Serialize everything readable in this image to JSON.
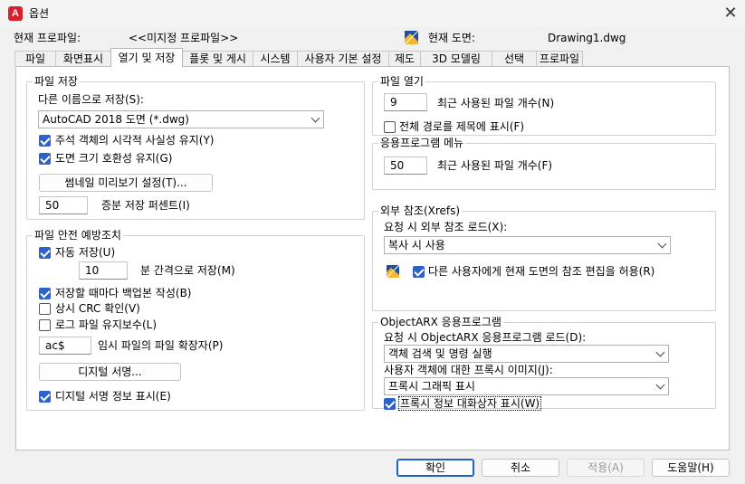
{
  "window": {
    "title": "옵션",
    "app_icon": "A",
    "close_glyph": "✕"
  },
  "header": {
    "profile_label": "현재 프로파일:",
    "profile_value": "<<미지정 프로파일>>",
    "drawing_label": "현재 도면:",
    "drawing_value": "Drawing1.dwg"
  },
  "tabs": [
    {
      "label": "파일"
    },
    {
      "label": "화면표시"
    },
    {
      "label": "열기 및 저장"
    },
    {
      "label": "플롯 및 게시"
    },
    {
      "label": "시스템"
    },
    {
      "label": "사용자 기본 설정"
    },
    {
      "label": "제도"
    },
    {
      "label": "3D 모델링"
    },
    {
      "label": "선택"
    },
    {
      "label": "프로파일"
    }
  ],
  "file_save": {
    "legend": "파일 저장",
    "save_as_label": "다른 이름으로 저장(S):",
    "save_as_value": "AutoCAD 2018 도면 (*.dwg)",
    "annotative_label": "주석 객체의 시각적 사실성 유지(Y)",
    "annotative_checked": true,
    "drawing_size_label": "도면 크기 호환성 유지(G)",
    "drawing_size_checked": true,
    "thumbnail_button": "썸네일 미리보기 설정(T)...",
    "incremental_value": "50",
    "incremental_label": "증분 저장 퍼센트(I)"
  },
  "file_safety": {
    "legend": "파일 안전 예방조치",
    "autosave_label": "자동 저장(U)",
    "autosave_checked": true,
    "interval_value": "10",
    "interval_label": "분 간격으로 저장(M)",
    "backup_label": "저장할 때마다 백업본 작성(B)",
    "backup_checked": true,
    "crc_label": "상시 CRC 확인(V)",
    "crc_checked": false,
    "log_label": "로그 파일 유지보수(L)",
    "log_checked": false,
    "temp_ext_value": "ac$",
    "temp_ext_label": "임시 파일의 파일 확장자(P)",
    "digital_sig_button": "디지털 서명...",
    "show_sig_label": "디지털 서명 정보 표시(E)",
    "show_sig_checked": true
  },
  "file_open": {
    "legend": "파일 열기",
    "recent_value": "9",
    "recent_label": "최근 사용된 파일 개수(N)",
    "full_path_label": "전체 경로를 제목에 표시(F)",
    "full_path_checked": false
  },
  "app_menu": {
    "legend": "응용프로그램 메뉴",
    "recent_value": "50",
    "recent_label": "최근 사용된 파일 개수(F)"
  },
  "xrefs": {
    "legend": "외부 참조(Xrefs)",
    "demand_label": "요청 시 외부 참조 로드(X):",
    "demand_value": "복사 시 사용",
    "allow_edit_label": "다른 사용자에게 현재 도면의 참조 편집을 허용(R)",
    "allow_edit_checked": true
  },
  "objectarx": {
    "legend": "ObjectARX 응용프로그램",
    "demand_label": "요청 시 ObjectARX 응용프로그램 로드(D):",
    "demand_value": "객체 검색 및 명령 실행",
    "proxy_label": "사용자 객체에 대한 프록시 이미지(J):",
    "proxy_value": "프록시 그래픽 표시",
    "proxy_dialog_label": "프록시 정보 대화상자 표시(W)",
    "proxy_dialog_checked": true
  },
  "footer": {
    "ok": "확인",
    "cancel": "취소",
    "apply": "적용(A)",
    "help": "도움말(H)"
  },
  "colors": {
    "accent": "#2c62c9",
    "brand": "#d6202c"
  }
}
